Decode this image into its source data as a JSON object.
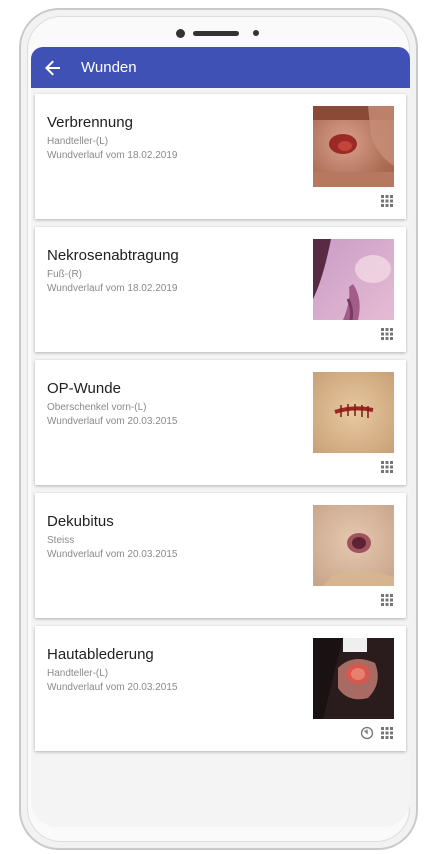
{
  "app_bar": {
    "title": "Wunden",
    "back_icon": "arrow-left-icon",
    "color": "#3f51b5"
  },
  "wounds": [
    {
      "title": "Verbrennung",
      "location": "Handteller-(L)",
      "history": "Wundverlauf vom 18.02.2019",
      "icons": [
        "grid-icon"
      ]
    },
    {
      "title": "Nekrosenabtragung",
      "location": "Fuß-(R)",
      "history": "Wundverlauf vom 18.02.2019",
      "icons": [
        "grid-icon"
      ]
    },
    {
      "title": "OP-Wunde",
      "location": "Oberschenkel vorn-(L)",
      "history": "Wundverlauf vom 20.03.2015",
      "icons": [
        "grid-icon"
      ]
    },
    {
      "title": "Dekubitus",
      "location": "Steiss",
      "history": "Wundverlauf vom 20.03.2015",
      "icons": [
        "grid-icon"
      ]
    },
    {
      "title": "Hautablederung",
      "location": "Handteller-(L)",
      "history": "Wundverlauf vom 20.03.2015",
      "icons": [
        "timer-icon",
        "grid-icon"
      ]
    }
  ]
}
